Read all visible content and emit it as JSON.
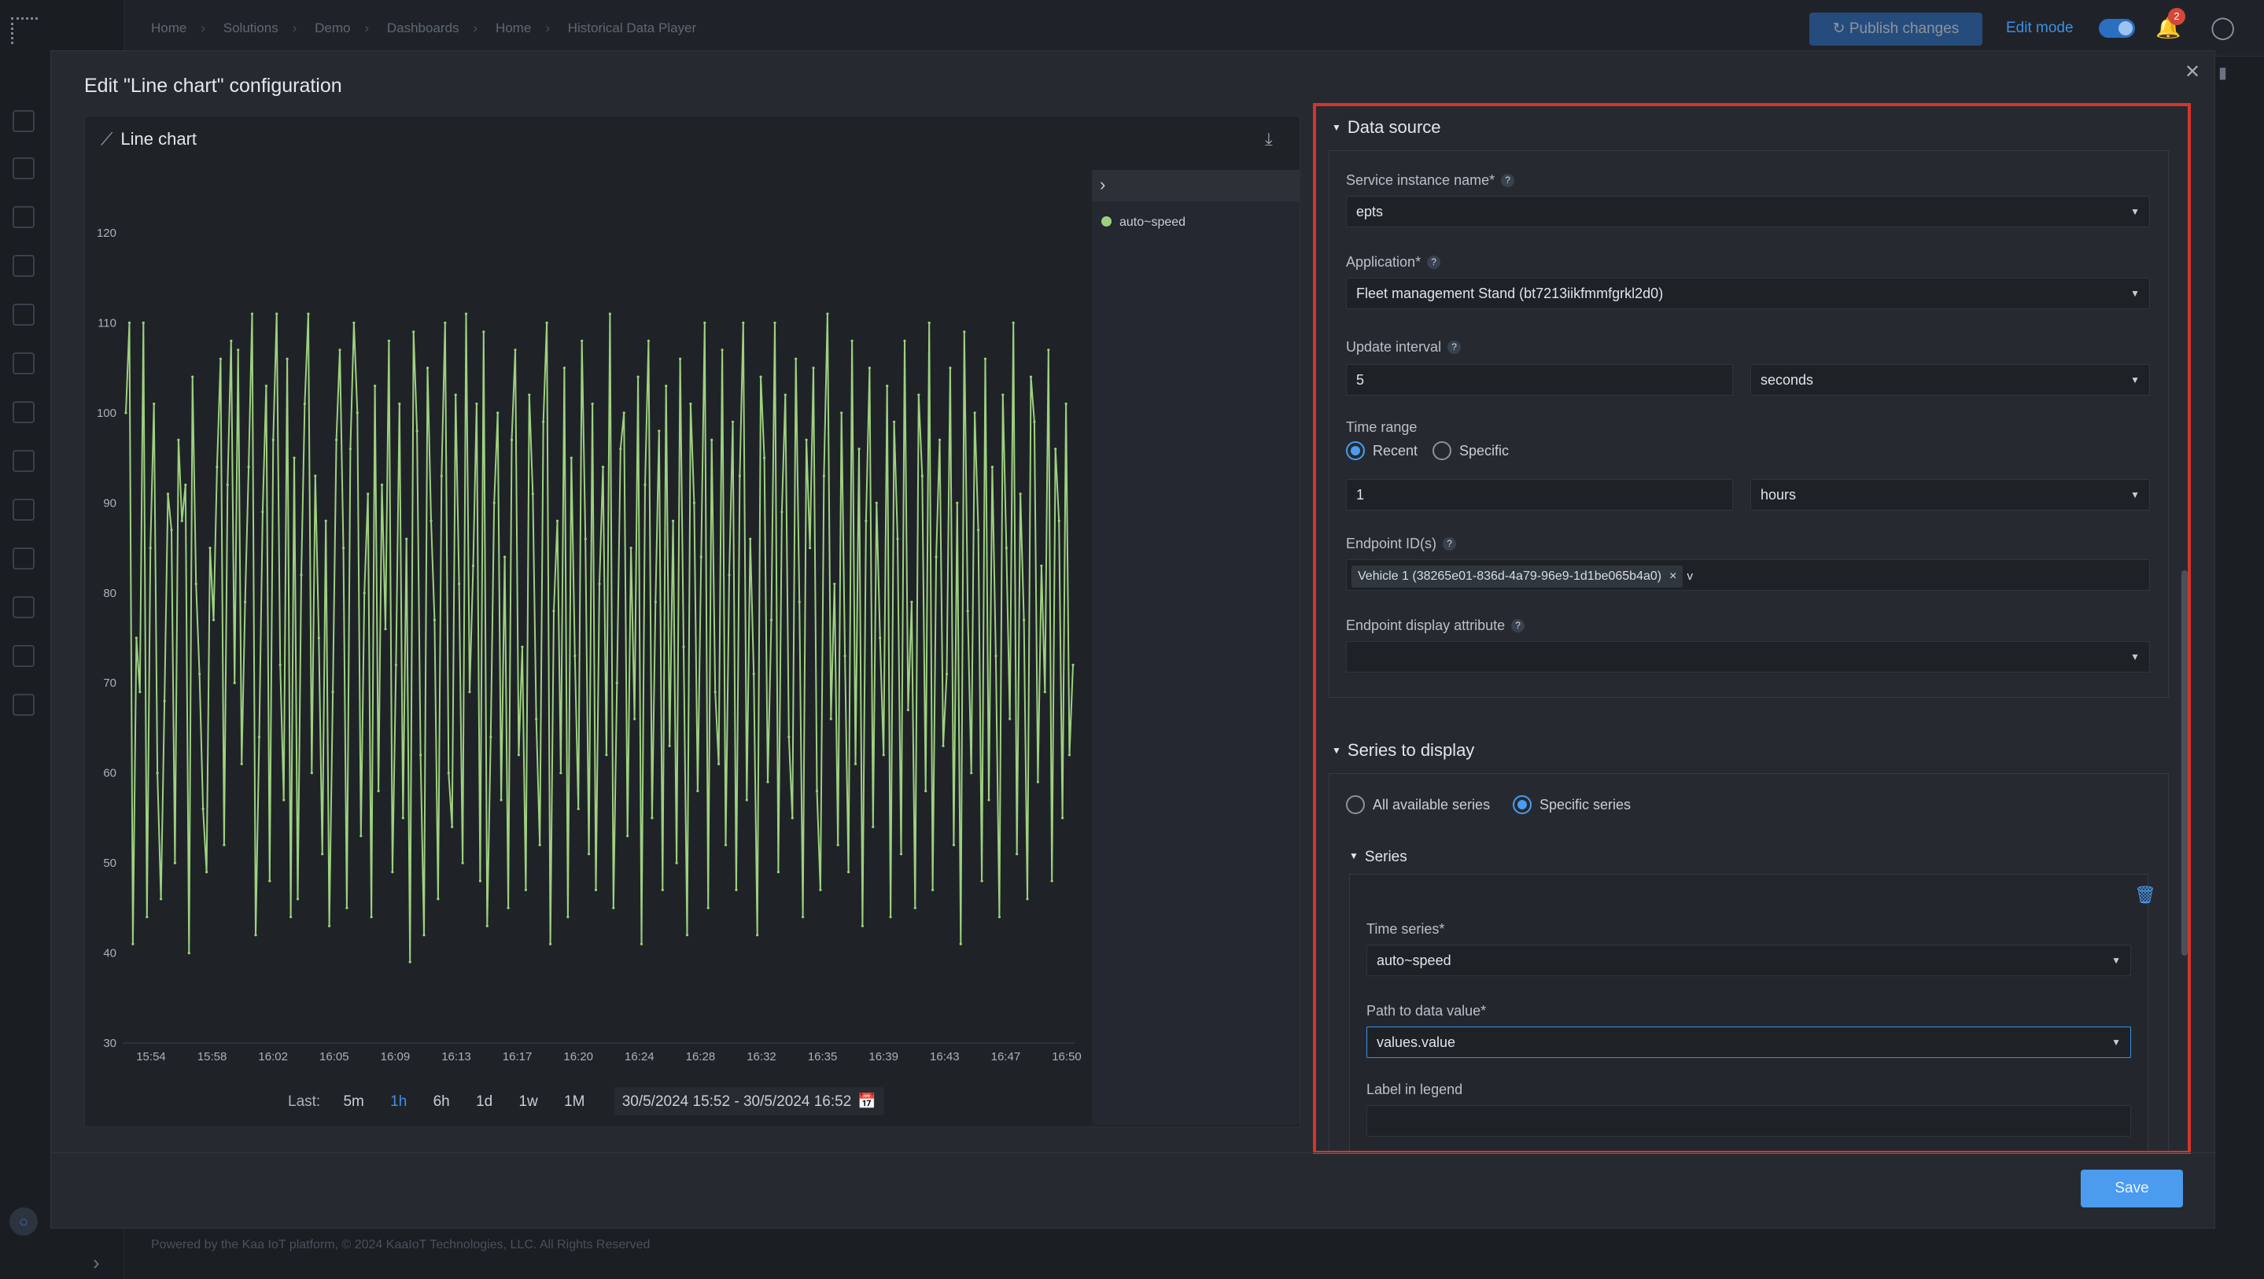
{
  "topbar": {
    "breadcrumbs": [
      "Home",
      "Solutions",
      "Demo",
      "Dashboards",
      "Home",
      "Historical Data Player"
    ],
    "publish_label": "Publish changes",
    "edit_mode_label": "Edit mode",
    "notification_count": "2"
  },
  "footer": {
    "text": "Powered by the Kaa IoT platform, © 2024 KaaIoT Technologies, LLC. All Rights Reserved"
  },
  "modal": {
    "title": "Edit \"Line chart\" configuration",
    "save_label": "Save"
  },
  "preview": {
    "title": "Line chart",
    "range_label": "Last:",
    "range_options": [
      "5m",
      "1h",
      "6h",
      "1d",
      "1w",
      "1M"
    ],
    "active_range": "1h",
    "date_range": "30/5/2024 15:52 - 30/5/2024 16:52"
  },
  "chart_data": {
    "type": "line",
    "title": "Line chart",
    "series": [
      {
        "name": "auto~speed",
        "color": "#9ed17f",
        "values": [
          100,
          110,
          41,
          75,
          69,
          110,
          44,
          85,
          101,
          60,
          46,
          68,
          91,
          87,
          50,
          97,
          88,
          92,
          40,
          104,
          81,
          71,
          56,
          49,
          85,
          77,
          94,
          106,
          52,
          92,
          108,
          70,
          107,
          61,
          79,
          94,
          111,
          42,
          64,
          89,
          103,
          48,
          97,
          111,
          72,
          57,
          106,
          44,
          95,
          46,
          82,
          101,
          111,
          60,
          93,
          75,
          51,
          88,
          43,
          69,
          97,
          107,
          85,
          45,
          96,
          110,
          100,
          53,
          80,
          91,
          44,
          103,
          58,
          92,
          76,
          108,
          49,
          72,
          101,
          55,
          86,
          39,
          109,
          98,
          62,
          42,
          105,
          88,
          77,
          46,
          93,
          110,
          60,
          54,
          102,
          81,
          50,
          111,
          69,
          83,
          101,
          48,
          109,
          43,
          64,
          90,
          100,
          57,
          84,
          45,
          97,
          107,
          62,
          74,
          47,
          102,
          91,
          66,
          52,
          99,
          110,
          41,
          78,
          88,
          60,
          105,
          44,
          95,
          73,
          56,
          108,
          86,
          51,
          101,
          47,
          81,
          94,
          62,
          111,
          45,
          70,
          96,
          100,
          53,
          85,
          66,
          104,
          41,
          92,
          108,
          55,
          79,
          98,
          47,
          103,
          63,
          88,
          50,
          106,
          74,
          42,
          101,
          90,
          58,
          84,
          110,
          45,
          97,
          69,
          61,
          107,
          52,
          82,
          99,
          47,
          93,
          110,
          57,
          86,
          71,
          42,
          104,
          95,
          59,
          77,
          110,
          49,
          89,
          102,
          64,
          55,
          106,
          79,
          44,
          97,
          85,
          105,
          58,
          47,
          93,
          111,
          66,
          81,
          52,
          100,
          73,
          49,
          108,
          61,
          96,
          43,
          88,
          105,
          54,
          90,
          75,
          62,
          103,
          44,
          99,
          86,
          51,
          108,
          67,
          79,
          45,
          102,
          93,
          58,
          110,
          47,
          84,
          97,
          63,
          71,
          105,
          52,
          90,
          41,
          109,
          78,
          60,
          100,
          87,
          48,
          106,
          57,
          94,
          73,
          44,
          102,
          85,
          66,
          110,
          51,
          91,
          77,
          46,
          104,
          99,
          59,
          83,
          69,
          107,
          48,
          96,
          88,
          55,
          101,
          62,
          72
        ]
      }
    ],
    "x_ticks": [
      "15:54",
      "15:58",
      "16:02",
      "16:05",
      "16:09",
      "16:13",
      "16:17",
      "16:20",
      "16:24",
      "16:28",
      "16:32",
      "16:35",
      "16:39",
      "16:43",
      "16:47",
      "16:50"
    ],
    "y_ticks": [
      30,
      40,
      50,
      60,
      70,
      80,
      90,
      100,
      110,
      120
    ],
    "ylim": [
      30,
      120
    ],
    "grid": false,
    "legend": "right"
  },
  "config": {
    "data_source": {
      "title": "Data source",
      "service_label": "Service instance name",
      "service_value": "epts",
      "app_label": "Application",
      "app_value": "Fleet management Stand (bt7213iikfmmfgrkl2d0)",
      "interval_label": "Update interval",
      "interval_value": "5",
      "interval_unit": "seconds",
      "time_range_label": "Time range",
      "time_range_options": [
        "Recent",
        "Specific"
      ],
      "time_range_selected": "Recent",
      "range_value": "1",
      "range_unit": "hours",
      "endpoint_label": "Endpoint ID(s)",
      "endpoint_chip": "Vehicle 1 (38265e01-836d-4a79-96e9-1d1be065b4a0)",
      "endpoint_extra": "v",
      "display_attr_label": "Endpoint display attribute",
      "display_attr_value": ""
    },
    "series_to_display": {
      "title": "Series to display",
      "options": [
        "All available series",
        "Specific series"
      ],
      "selected": "Specific series",
      "series_title": "Series",
      "time_series_label": "Time series",
      "time_series_value": "auto~speed",
      "path_label": "Path to data value",
      "path_value": "values.value",
      "legend_label": "Label in legend",
      "legend_value": ""
    }
  }
}
